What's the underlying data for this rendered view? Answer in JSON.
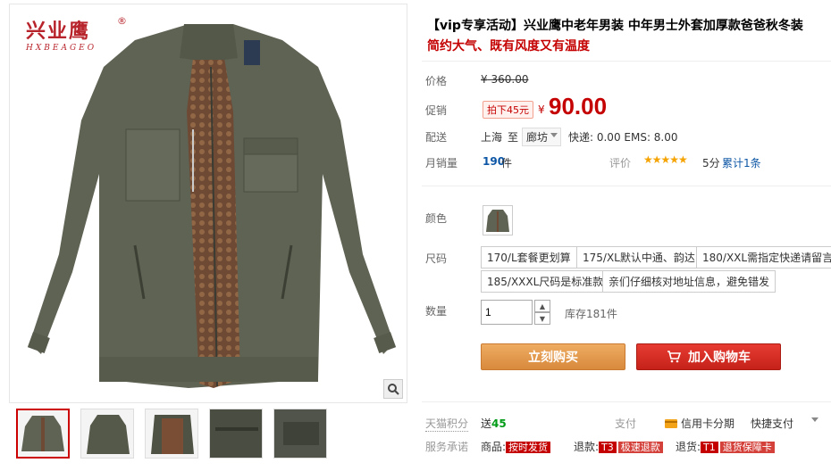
{
  "brand": {
    "name": "兴业鹰",
    "reg": "®",
    "sub": "HXBEAGEO"
  },
  "title": "【vip专享活动】兴业鹰中老年男装 中年男士外套加厚款爸爸秋冬装",
  "subtitle": "简约大气、既有风度又有温度",
  "price": {
    "label": "价格",
    "currency": "¥",
    "original": "360.00"
  },
  "promo": {
    "label": "促销",
    "badge": "拍下45元",
    "currency": "¥",
    "price": "90.00"
  },
  "shipping": {
    "label": "配送",
    "from": "上海",
    "to_word": "至",
    "destination": "廊坊",
    "fees": "快递: 0.00 EMS: 8.00"
  },
  "sales": {
    "label": "月销量",
    "count": "190",
    "unit": "件",
    "rating_label": "评价",
    "stars": "★★★★★",
    "score": "5分",
    "reviews": "累计1条"
  },
  "color": {
    "label": "颜色"
  },
  "size": {
    "label": "尺码",
    "options": [
      "170/L套餐更划算",
      "175/XL默认中通、韵达",
      "180/XXL需指定快递请留言",
      "185/XXXL尺码是标准款",
      "亲们仔细核对地址信息，避免错发"
    ]
  },
  "quantity": {
    "label": "数量",
    "value": "1",
    "stock": "库存181件"
  },
  "buttons": {
    "buy": "立刻购买",
    "cart": "加入购物车"
  },
  "bottom": {
    "points_label": "天猫积分",
    "points_prefix": "送",
    "points_value": "45",
    "pay_label": "支付",
    "credit": "信用卡分期",
    "quick_pay": "快捷支付",
    "promise_label": "服务承诺",
    "goods_label": "商品:",
    "goods_tag": "按时发货",
    "refund_label": "退款:",
    "refund_code": "T3",
    "refund_text": "极速退款",
    "return_label": "退货:",
    "return_code": "T1",
    "return_text": "退货保障卡"
  },
  "colors": {
    "accent_red": "#c40000",
    "buy_orange": "#e9a559",
    "cart_red": "#d42a22",
    "link_blue": "#0c56a5",
    "star_gold": "#f5a300"
  }
}
